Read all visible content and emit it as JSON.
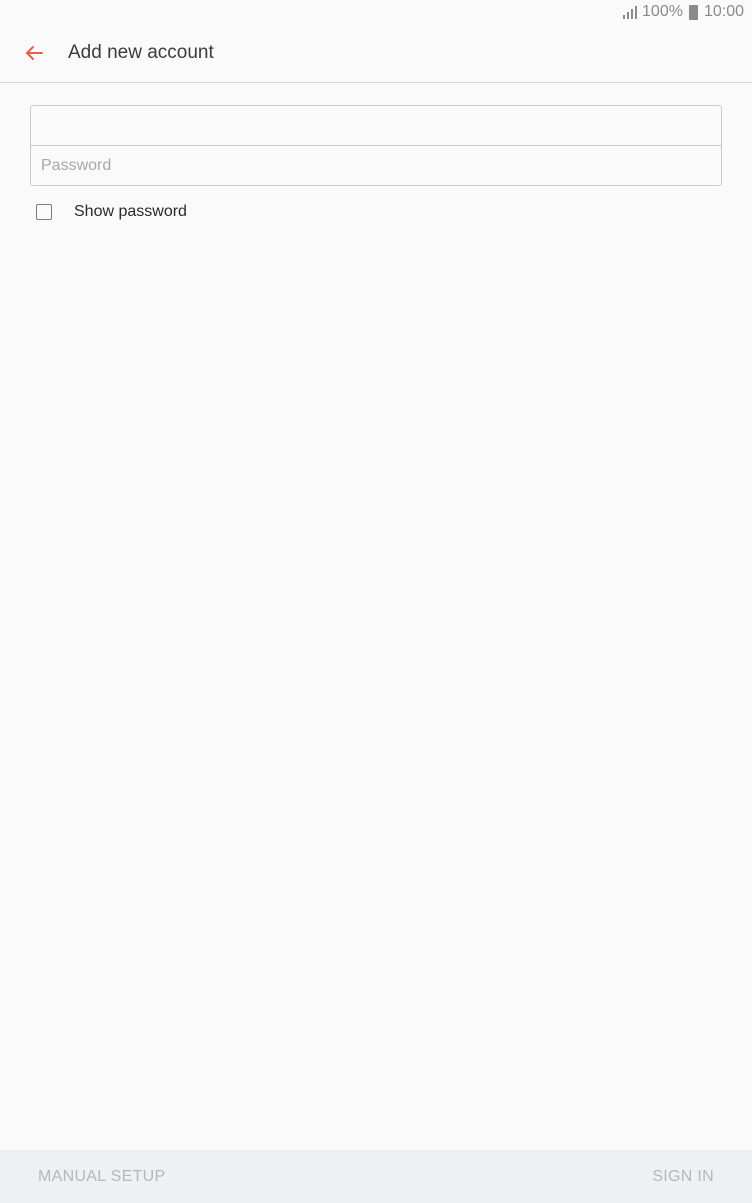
{
  "status_bar": {
    "battery": "100%",
    "time": "10:00",
    "icons": [
      "signal-icon",
      "battery-icon"
    ]
  },
  "app_bar": {
    "title": "Add new account",
    "back_icon": "arrow-left-icon",
    "accent_color": "#e8604c"
  },
  "form": {
    "email": {
      "value": "",
      "placeholder": ""
    },
    "password": {
      "value": "",
      "placeholder": "Password"
    },
    "show_password": {
      "label": "Show password",
      "checked": false
    }
  },
  "bottom_bar": {
    "manual_setup_label": "MANUAL SETUP",
    "sign_in_label": "SIGN IN"
  }
}
